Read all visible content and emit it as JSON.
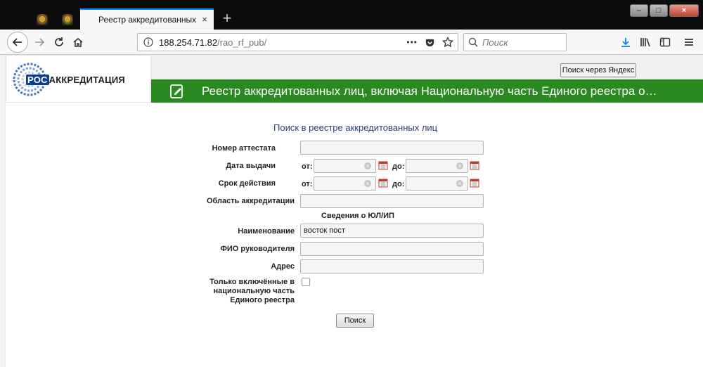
{
  "browser": {
    "active_tab_title": "Реестр аккредитованных лиц",
    "new_tab_label": "+",
    "close_tab_glyph": "×",
    "url_host": "188.254.71.82",
    "url_path": "/rao_rf_pub/",
    "url_more": "•••",
    "search_placeholder": "Поиск",
    "window_controls": [
      "–",
      "□",
      "×"
    ]
  },
  "page": {
    "logo_ros": "РОС",
    "logo_rest": "АККРЕДИТАЦИЯ",
    "yandex_button": "Поиск через Яндекс",
    "banner_title": "Реестр аккредитованных лиц, включая Национальную часть Единого реестра о…"
  },
  "form": {
    "title": "Поиск в реестре аккредитованных лиц",
    "certificate_number_label": "Номер аттестата",
    "issue_date_label": "Дата выдачи",
    "validity_label": "Срок действия",
    "from_label": "от:",
    "to_label": "до:",
    "accreditation_area_label": "Область аккредитации",
    "entity_section": "Сведения о ЮЛ/ИП",
    "name_label": "Наименование",
    "name_value": "восток пост",
    "director_label": "ФИО руководителя",
    "address_label": "Адрес",
    "national_only_label_1": "Только включённые в",
    "national_only_label_2": "национальную часть",
    "national_only_label_3": "Единого реестра",
    "search_button": "Поиск"
  },
  "colors": {
    "banner_green": "#2a8a21",
    "form_title_blue": "#2f3a78",
    "tab_accent": "#0a84ff",
    "logo_blue": "#0d3f8e"
  }
}
